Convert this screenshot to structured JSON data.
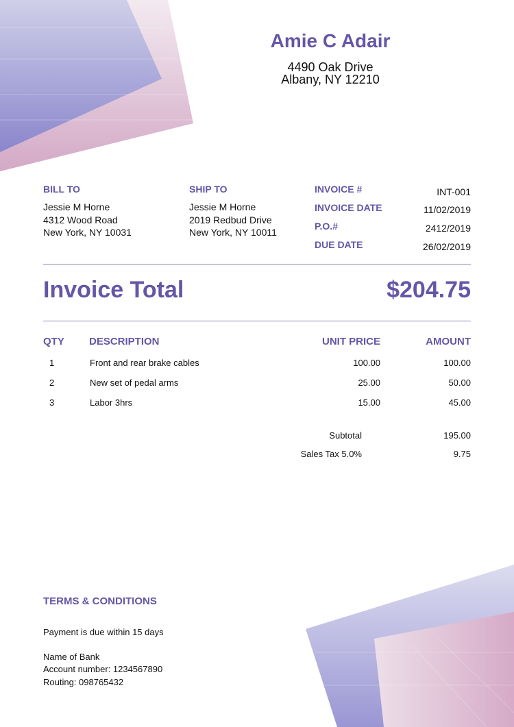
{
  "sender": {
    "name": "Amie C Adair",
    "address_line1": "4490 Oak Drive",
    "address_line2": "Albany, NY 12210"
  },
  "bill_to": {
    "label": "BILL TO",
    "name": "Jessie M Horne",
    "address_line1": "4312 Wood Road",
    "address_line2": "New York, NY 10031"
  },
  "ship_to": {
    "label": "SHIP TO",
    "name": "Jessie M Horne",
    "address_line1": "2019 Redbud Drive",
    "address_line2": "New York, NY 10011"
  },
  "meta": [
    {
      "label": "INVOICE #",
      "value": "INT-001"
    },
    {
      "label": "INVOICE DATE",
      "value": "11/02/2019"
    },
    {
      "label": "P.O.#",
      "value": "2412/2019"
    },
    {
      "label": "DUE DATE",
      "value": "26/02/2019"
    }
  ],
  "total": {
    "label": "Invoice Total",
    "value": "$204.75"
  },
  "table": {
    "headers": {
      "qty": "QTY",
      "description": "DESCRIPTION",
      "unit_price": "UNIT PRICE",
      "amount": "AMOUNT"
    },
    "rows": [
      {
        "qty": "1",
        "description": "Front and rear brake cables",
        "unit_price": "100.00",
        "amount": "100.00"
      },
      {
        "qty": "2",
        "description": "New set of pedal arms",
        "unit_price": "25.00",
        "amount": "50.00"
      },
      {
        "qty": "3",
        "description": "Labor 3hrs",
        "unit_price": "15.00",
        "amount": "45.00"
      }
    ]
  },
  "summary": [
    {
      "label": "Subtotal",
      "value": "195.00"
    },
    {
      "label": "Sales Tax 5.0%",
      "value": "9.75"
    }
  ],
  "terms": {
    "title": "TERMS & CONDITIONS",
    "payment_note": "Payment is due within 15 days",
    "bank_name": "Name of Bank",
    "account_number": "Account number: 1234567890",
    "routing": "Routing: 098765432"
  },
  "colors": {
    "accent": "#6556a6",
    "rule": "#8e82b8"
  }
}
